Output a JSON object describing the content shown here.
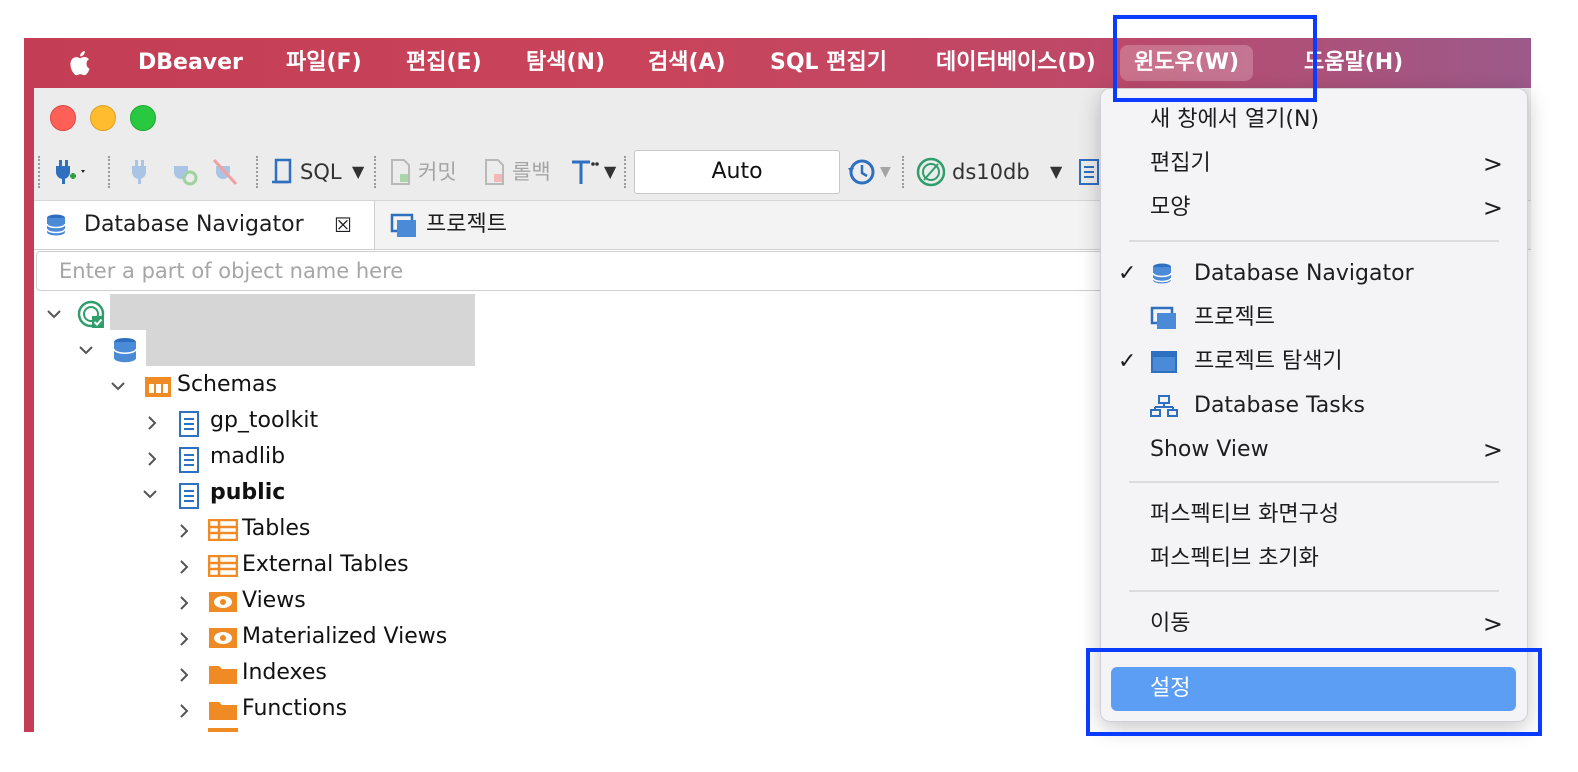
{
  "menubar": {
    "app_name": "DBeaver",
    "items": [
      "파일(F)",
      "편집(E)",
      "탐색(N)",
      "검색(A)",
      "SQL 편집기",
      "데이터베이스(D)",
      "윈도우(W)",
      "도움말(H)"
    ],
    "active_item": "윈도우(W)"
  },
  "toolbar": {
    "sql_label": "SQL",
    "commit_label": "커밋",
    "rollback_label": "롤백",
    "transaction_mode": "Auto",
    "datasource": "ds10db"
  },
  "tabs": [
    {
      "label": "Database Navigator",
      "active": true
    },
    {
      "label": "프로젝트",
      "active": false
    }
  ],
  "search": {
    "placeholder": "Enter a part of object name here"
  },
  "tree": {
    "schemas_label": "Schemas",
    "schemas": [
      "gp_toolkit",
      "madlib",
      "public"
    ],
    "public_children": [
      "Tables",
      "External Tables",
      "Views",
      "Materialized Views",
      "Indexes",
      "Functions"
    ]
  },
  "window_menu": {
    "items": [
      {
        "label": "새 창에서 열기(N)"
      },
      {
        "label": "편집기",
        "submenu": true
      },
      {
        "label": "모양",
        "submenu": true
      },
      {
        "label": "Database Navigator",
        "checked": true,
        "icon": "database-navigator-icon"
      },
      {
        "label": "프로젝트",
        "checked": false,
        "icon": "project-icon"
      },
      {
        "label": "프로젝트 탐색기",
        "checked": true,
        "icon": "project-explorer-icon"
      },
      {
        "label": "Database Tasks",
        "checked": false,
        "icon": "database-tasks-icon"
      },
      {
        "label": "Show View",
        "submenu": true
      },
      {
        "label": "퍼스펙티브 화면구성"
      },
      {
        "label": "퍼스펙티브 초기화"
      },
      {
        "label": "이동",
        "submenu": true
      },
      {
        "label": "설정",
        "selected": true
      }
    ]
  },
  "colors": {
    "highlight_box": "#0a3cff",
    "selected_item": "#5d9ef5",
    "menubar": "#c33d55",
    "folder_orange": "#f08a24"
  }
}
